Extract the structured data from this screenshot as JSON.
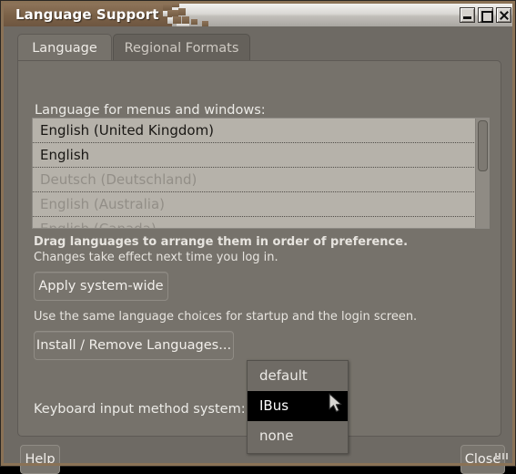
{
  "window": {
    "title": "Language Support",
    "controls": {
      "minimize": "minimize-button",
      "maximize": "maximize-button",
      "close": "close-button"
    }
  },
  "tabs": [
    {
      "label": "Language",
      "active": true
    },
    {
      "label": "Regional Formats",
      "active": false
    }
  ],
  "panel": {
    "language_list_label": "Language for menus and windows:",
    "languages": [
      {
        "name": "English (United Kingdom)",
        "enabled": true
      },
      {
        "name": "English",
        "enabled": true
      },
      {
        "name": "Deutsch (Deutschland)",
        "enabled": false
      },
      {
        "name": "English (Australia)",
        "enabled": false
      },
      {
        "name": "English (Canada)",
        "enabled": false
      }
    ],
    "hint_drag": "Drag languages to arrange them in order of preference.",
    "hint_login": "Changes take effect next time you log in.",
    "apply_button": "Apply system-wide",
    "hint_apply": "Use the same language choices for startup and the login screen.",
    "install_button": "Install / Remove Languages...",
    "keyboard_label": "Keyboard input method system:"
  },
  "dropdown": {
    "open": true,
    "selected": "IBus",
    "options": [
      {
        "label": "default",
        "selected": false
      },
      {
        "label": "IBus",
        "selected": true
      },
      {
        "label": "none",
        "selected": false
      }
    ]
  },
  "footer": {
    "help_button": "Help",
    "close_button": "Close"
  },
  "colors": {
    "titlebar_brown": "#7b6248",
    "titlebar_silver": "#d9d7d3",
    "window_bg": "#6e6a64",
    "panel_bg": "#76726b",
    "list_bg": "#b6b2aa",
    "frame_border": "#8a7256",
    "selection_bg": "#000000"
  }
}
